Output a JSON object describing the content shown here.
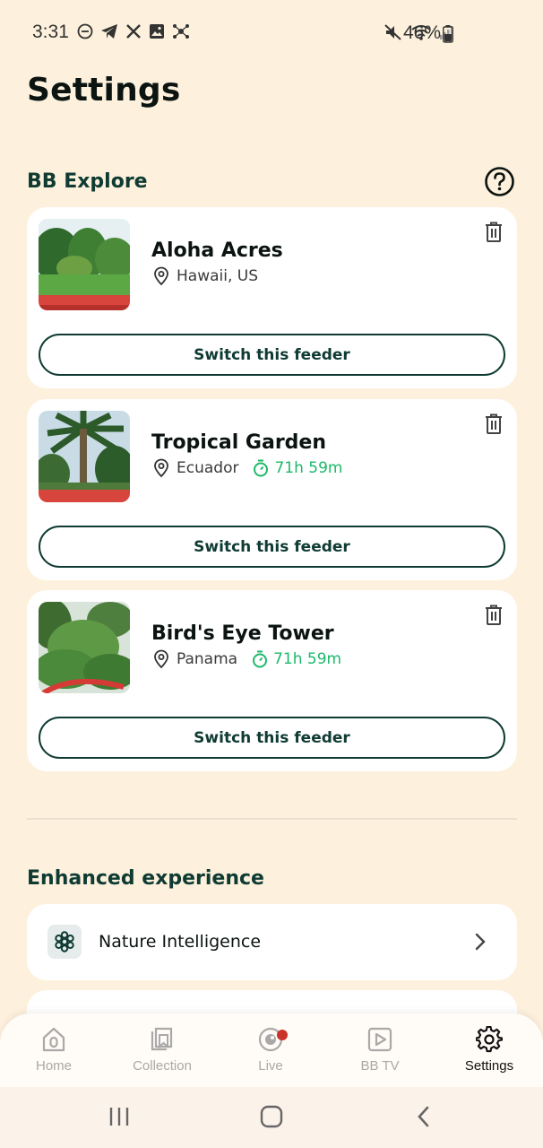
{
  "status_bar": {
    "time": "3:31",
    "battery": "46%",
    "left_icons": [
      "dnd-icon",
      "telegram-icon",
      "x-icon",
      "image-icon",
      "network-icon"
    ],
    "right_icons": [
      "mute-icon",
      "wifi-icon",
      "signal-icon",
      "battery-icon"
    ]
  },
  "page": {
    "title": "Settings"
  },
  "bb_explore": {
    "title": "BB Explore",
    "help_icon": "help-circle-icon",
    "feeders": [
      {
        "name": "Aloha Acres",
        "location": "Hawaii, US",
        "timer": "",
        "button": "Switch this feeder"
      },
      {
        "name": "Tropical Garden",
        "location": "Ecuador",
        "timer": "71h 59m",
        "button": "Switch this feeder"
      },
      {
        "name": "Bird's Eye Tower",
        "location": "Panama",
        "timer": "71h 59m",
        "button": "Switch this feeder"
      }
    ]
  },
  "enhanced": {
    "title": "Enhanced experience",
    "items": [
      {
        "label": "Nature Intelligence",
        "icon": "nature-intelligence-icon"
      }
    ]
  },
  "bottom_nav": {
    "items": [
      {
        "label": "Home",
        "icon": "home-icon",
        "active": false
      },
      {
        "label": "Collection",
        "icon": "collection-icon",
        "active": false
      },
      {
        "label": "Live",
        "icon": "live-icon",
        "active": false
      },
      {
        "label": "BB TV",
        "icon": "tv-icon",
        "active": false
      },
      {
        "label": "Settings",
        "icon": "gear-icon",
        "active": true
      }
    ]
  },
  "colors": {
    "background": "#FDF1DD",
    "accent_dark": "#0F3B33",
    "timer_green": "#1DB96A",
    "live_dot": "#C8332A"
  }
}
